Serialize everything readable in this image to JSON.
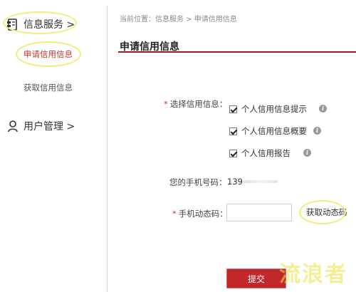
{
  "sidebar": {
    "services_label": "信息服务 >",
    "items": [
      {
        "label": "申请信用信息"
      },
      {
        "label": "获取信用信息"
      }
    ],
    "user_label": "用户管理 >"
  },
  "breadcrumb": "当前位置：信息服务 > 申请信用信息",
  "page_title": "申请信用信息",
  "form": {
    "select_label": "选择信用信息：",
    "options": [
      {
        "label": "个人信用信息提示",
        "checked": true
      },
      {
        "label": "个人信用信息概要",
        "checked": true
      },
      {
        "label": "个人信用报告",
        "checked": true
      }
    ],
    "phone_label": "您的手机号码：",
    "phone_value": "139",
    "code_label": "手机动态码：",
    "code_value": "",
    "get_code_label": "获取动态码",
    "submit_label": "提交"
  },
  "required_mark": "*",
  "info_glyph": "i",
  "watermark": "流浪者",
  "colors": {
    "accent": "#c0282b",
    "title_rule": "#9b1c1c",
    "highlight": "#f2ee7a"
  }
}
